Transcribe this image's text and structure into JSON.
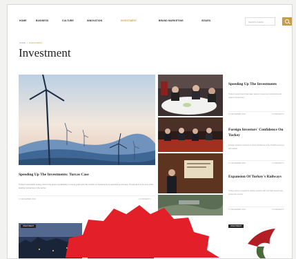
{
  "nav": {
    "items": [
      "HOME",
      "BUSINESS",
      "CULTURE",
      "INNOVATION",
      "INVESTMENT",
      "BRAND MARKETING",
      "ISSUES"
    ],
    "active_index": 4,
    "search_placeholder": "SEARCH HERE"
  },
  "breadcrumb": {
    "home": "HOME",
    "separator": "/",
    "current": "INVESTMENT"
  },
  "page_title": "Investment",
  "hero": {
    "title": "Speeding Up The Investments: Turcas Case",
    "excerpt": "Turkey's renewable energy sector has grown significantly in recent years and the number of investments is expected to increase. Turcas aims to be one of the leading companies in the sector.",
    "date": "17 DECEMBER 2018",
    "comments": "0 COMMENTS"
  },
  "side_articles": [
    {
      "title": "Speeding Up The Investments",
      "excerpt": "Turkey's government has taken steps to speed up investments and reduce bureaucracy.",
      "date": "17 DECEMBER 2018",
      "comments": "0 COMMENTS"
    },
    {
      "title": "Foreign Investors' Confidence On Turkey",
      "excerpt": "Foreign investors continue to show confidence in the Turkish economy and market.",
      "date": "17 DECEMBER 2018",
      "comments": "0 COMMENTS"
    },
    {
      "title": "Expansion Of Turkey's Railways",
      "excerpt": "Turkey plans to expand its railway network with new high speed lines across the country.",
      "date": "17 DECEMBER 2018",
      "comments": "0 COMMENTS"
    }
  ],
  "bottom_tags": [
    "INVESTMENT",
    "INVESTMENT",
    "INVESTMENT"
  ],
  "colors": {
    "accent": "#c69d4b",
    "badge": "#e3202a",
    "text": "#222222"
  }
}
